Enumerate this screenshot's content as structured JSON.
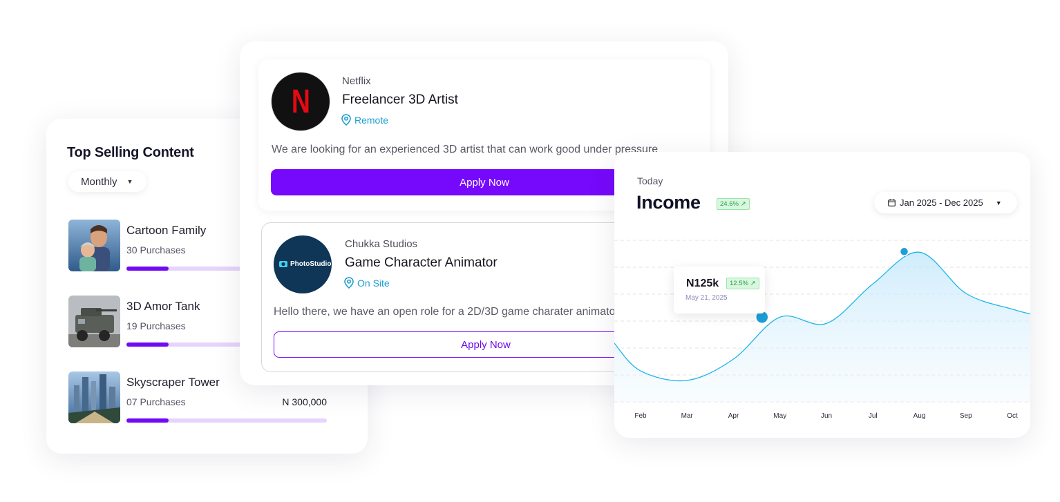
{
  "top_selling": {
    "title": "Top Selling Content",
    "period": "Monthly",
    "items": [
      {
        "name": "Cartoon Family",
        "purchases": "30 Purchases",
        "price": "",
        "progress": 0.21
      },
      {
        "name": "3D Amor Tank",
        "purchases": "19 Purchases",
        "price": "",
        "progress": 0.21
      },
      {
        "name": "Skyscraper Tower",
        "purchases": "07 Purchases",
        "price": "N 300,000",
        "progress": 0.21
      }
    ]
  },
  "jobs": [
    {
      "company": "Netflix",
      "title": "Freelancer 3D Artist",
      "location": "Remote",
      "description": "We are looking for an experienced 3D artist that can work good under pressure",
      "apply_label": "Apply Now",
      "logo_text": "N"
    },
    {
      "company": "Chukka Studios",
      "title": "Game Character Animator",
      "location": "On Site",
      "description": "Hello there, we have an open role for a 2D/3D game charater animator",
      "apply_label": "Apply Now",
      "logo_text": "PhotoStudio"
    }
  ],
  "income": {
    "period_label": "Today",
    "title": "Income",
    "change": "24.6% ↗",
    "date_range": "Jan 2025 - Dec 2025",
    "tooltip": {
      "value": "N125k",
      "change": "12.5% ↗",
      "date": "May 21, 2025"
    },
    "colors": {
      "line": "#1cb5e8",
      "accent": "#23a046"
    }
  },
  "chart_data": {
    "type": "area",
    "categories": [
      "Feb",
      "Mar",
      "Apr",
      "May",
      "Jun",
      "Jul",
      "Aug",
      "Sep",
      "Oct"
    ],
    "values": [
      40,
      28,
      55,
      108,
      100,
      150,
      190,
      138,
      118
    ],
    "highlight": {
      "index": 3,
      "label": "N125k"
    },
    "ylim": [
      0,
      240
    ],
    "grid": true
  }
}
